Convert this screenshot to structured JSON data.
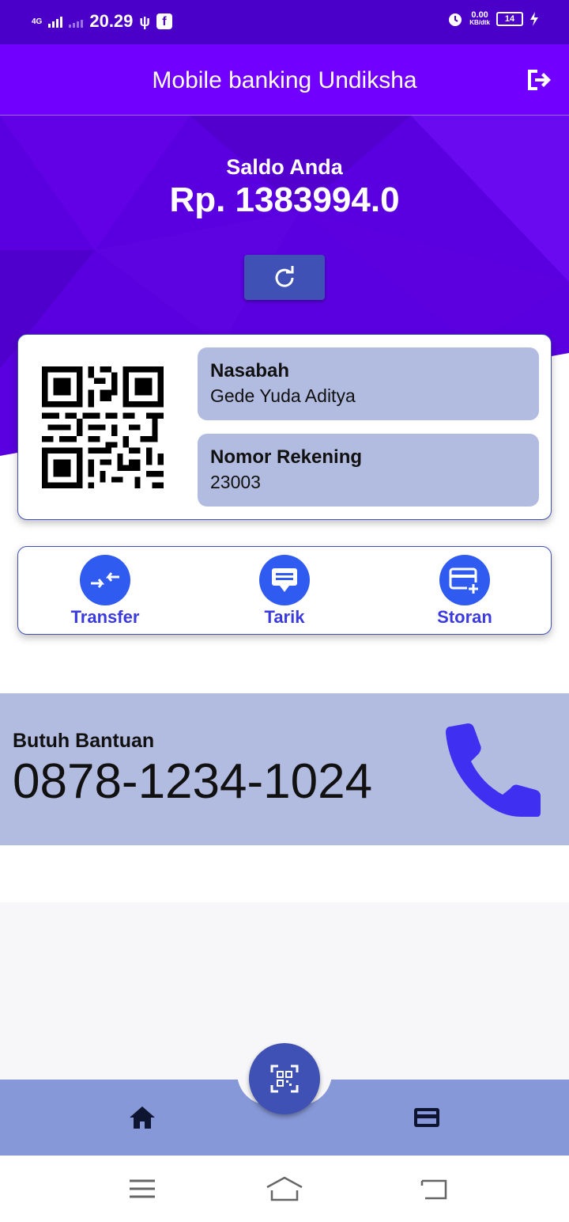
{
  "status_bar": {
    "network": "4G",
    "time": "20.29",
    "speed": "0.00",
    "speed_unit": "KB/dtk",
    "battery": "14"
  },
  "app_bar": {
    "title": "Mobile banking Undiksha",
    "logout_icon": "logout-icon"
  },
  "balance": {
    "label": "Saldo Anda",
    "value": "Rp. 1383994.0",
    "refresh_icon": "refresh-icon"
  },
  "account_card": {
    "qr_icon": "qr-code",
    "customer_label": "Nasabah",
    "customer_name": "Gede Yuda Aditya",
    "account_label": "Nomor Rekening",
    "account_number": "23003"
  },
  "actions": [
    {
      "label": "Transfer",
      "icon": "transfer-icon"
    },
    {
      "label": "Tarik",
      "icon": "withdraw-icon"
    },
    {
      "label": "Storan",
      "icon": "deposit-icon"
    }
  ],
  "help": {
    "label": "Butuh Bantuan",
    "phone": "0878-1234-1024",
    "icon": "phone-icon"
  },
  "bottom_nav": {
    "home_icon": "home-icon",
    "scan_icon": "qr-scan-icon",
    "card_icon": "card-icon"
  },
  "colors": {
    "status_bar": "#4a00c8",
    "app_bar": "#7100ff",
    "hero": "#5a00e0",
    "primary": "#3f51b5",
    "action_blue": "#2f5bf0",
    "info_box": "#b2bbe0",
    "bottom_nav": "#8798d9"
  }
}
